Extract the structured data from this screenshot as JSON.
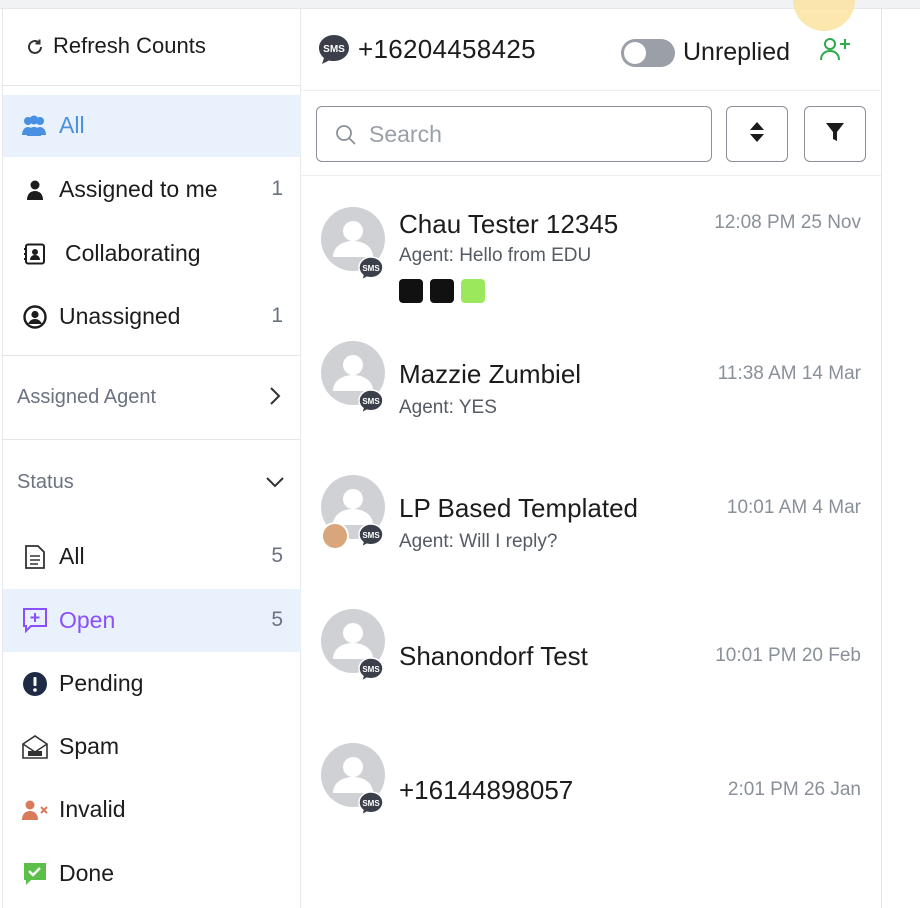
{
  "sidebar": {
    "refresh_label": "Refresh Counts",
    "views": [
      {
        "label": "All",
        "count": "",
        "active": true
      },
      {
        "label": "Assigned to me",
        "count": "1"
      },
      {
        "label": "Collaborating",
        "count": ""
      },
      {
        "label": "Unassigned",
        "count": "1"
      }
    ],
    "assigned_agent_label": "Assigned Agent",
    "status_label": "Status",
    "statuses": [
      {
        "label": "All",
        "count": "5"
      },
      {
        "label": "Open",
        "count": "5",
        "active": true
      },
      {
        "label": "Pending",
        "count": ""
      },
      {
        "label": "Spam",
        "count": ""
      },
      {
        "label": "Invalid",
        "count": ""
      },
      {
        "label": "Done",
        "count": ""
      }
    ]
  },
  "header": {
    "channel_badge": "SMS",
    "phone": "+16204458425",
    "unreplied_label": "Unreplied",
    "unreplied_on": false
  },
  "search": {
    "placeholder": "Search",
    "value": ""
  },
  "conversations": [
    {
      "name": "Chau Tester 12345",
      "preview": "Agent: Hello from EDU",
      "time": "12:08 PM 25 Nov",
      "badge": "SMS",
      "tags": [
        "#111111",
        "#111111",
        "#9be85c"
      ]
    },
    {
      "name": "Mazzie Zumbiel",
      "preview": "Agent: YES",
      "time": "11:38 AM 14 Mar",
      "badge": "SMS"
    },
    {
      "name": "LP Based Templated",
      "preview": "Agent: Will I reply?",
      "time": "10:01 AM 4 Mar",
      "badge": "SMS"
    },
    {
      "name": "Shanondorf Test",
      "preview": "",
      "time": "10:01 PM 20 Feb",
      "badge": "SMS"
    },
    {
      "name": "+16144898057",
      "preview": "",
      "time": "2:01 PM 26 Jan",
      "badge": "SMS"
    }
  ],
  "colors": {
    "active_bg": "#e8f1fc",
    "open_purple": "#8a4fff",
    "view_blue": "#4a90e2",
    "add_user_green": "#2eaa4a",
    "pending_navy": "#1f2a44",
    "invalid_orange": "#d97b5a",
    "done_green": "#5cbf4a"
  }
}
